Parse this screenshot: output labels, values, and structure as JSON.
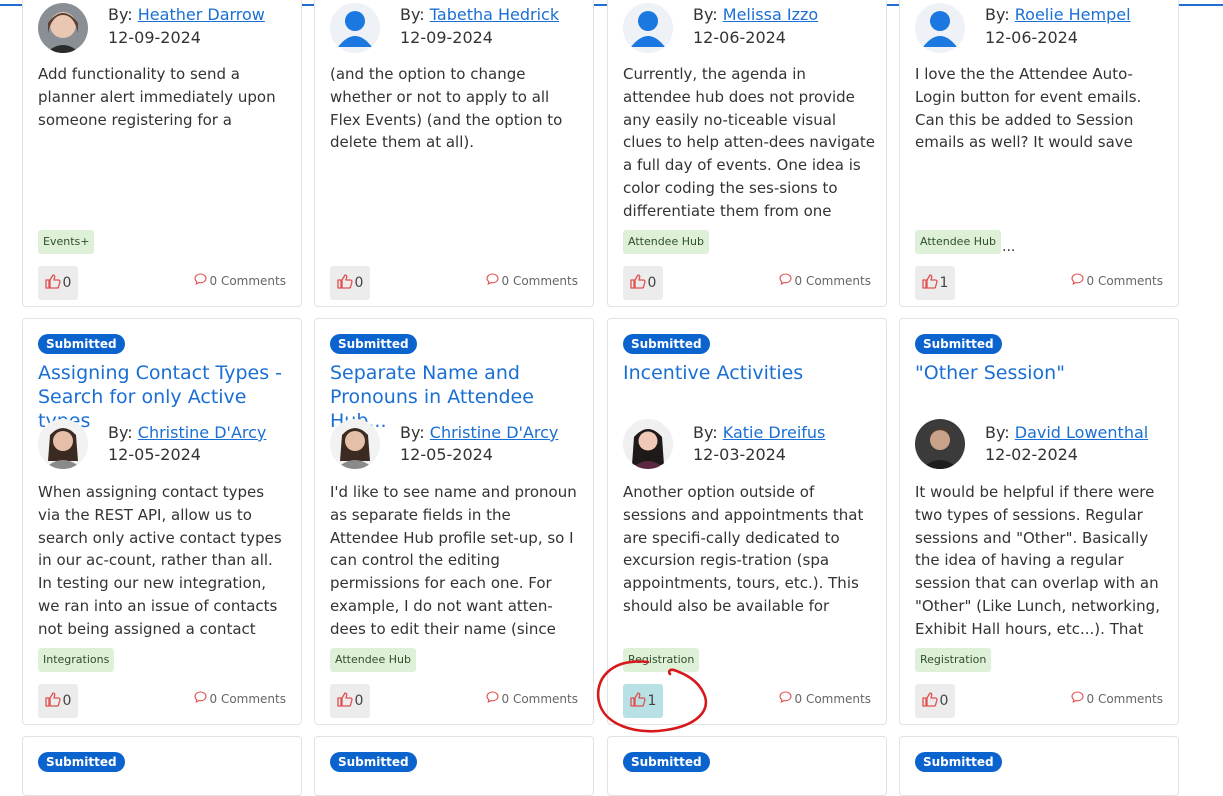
{
  "cards": [
    {
      "author": "Heather Darrow",
      "date": "12-09-2024",
      "description": "Add functionality to send a planner alert immediately upon someone registering for a specific session",
      "tag": "Events+",
      "likes": "0",
      "comments": "0 Comments"
    },
    {
      "author": "Tabetha Hedrick",
      "date": "12-09-2024",
      "description": "(and the option to change whether or not to apply to all Flex Events) (and the option to delete them at all).",
      "likes": "0",
      "comments": "0 Comments"
    },
    {
      "author": "Melissa Izzo",
      "date": "12-06-2024",
      "description": "Currently, the agenda in attendee hub does not provide any easily no-ticeable visual clues to help atten-dees navigate a full day of events. One idea is color coding the ses-sions to differentiate them from one another and make agenda scannin...",
      "tag": "Attendee Hub",
      "likes": "0",
      "comments": "0 Comments"
    },
    {
      "author": "Roelie Hempel",
      "date": "12-06-2024",
      "description": "I love the the Attendee Auto-Login button for event emails. Can this be added to Session emails as well? It would save participants a lot of hassle.",
      "tag": "Attendee Hub",
      "tag_more": "...",
      "likes": "1",
      "comments": "0 Comments"
    },
    {
      "status": "Submitted",
      "title": "Assigning Contact Types - Search for only Active types",
      "author": "Christine D'Arcy",
      "date": "12-05-2024",
      "description": "When assigning contact types via the REST API, allow us to search only active contact types in our ac-count, rather than all. In testing our new integration, we ran into an issue of contacts not being assigned a contact type because our list of...",
      "tag": "Integrations",
      "likes": "0",
      "comments": "0 Comments"
    },
    {
      "status": "Submitted",
      "title": "Separate Name and Pronouns in Attendee Hub...",
      "author": "Christine D'Arcy",
      "date": "12-05-2024",
      "description": "I'd like to see name and pronoun as separate fields in the Attendee Hub profile set-up, so I can control the editing permissions for each one. For example, I do not want atten-dees to edit their name (since invi-tees are added via API) but I would...",
      "tag": "Attendee Hub",
      "likes": "0",
      "comments": "0 Comments"
    },
    {
      "status": "Submitted",
      "title": "Incentive Activities",
      "author": "Katie Dreifus",
      "date": "12-03-2024",
      "description": "Another option outside of sessions and appointments that are specifi-cally dedicated to excursion regis-tration (spa appointments, tours, etc.). This should also be available for guest registration.",
      "tag": "Registration",
      "likes": "1",
      "comments": "0 Comments"
    },
    {
      "status": "Submitted",
      "title": "\"Other Session\"",
      "author": "David Lowenthal",
      "date": "12-02-2024",
      "description": "It would be helpful if there were two types of sessions. Regular sessions and \"Other\". Basically the idea of having a regular session that can overlap with an \"Other\" (Like Lunch, networking, Exhibit Hall hours, etc...). That way the attendee can...",
      "tag": "Registration",
      "likes": "0",
      "comments": "0 Comments"
    },
    {
      "status": "Submitted"
    },
    {
      "status": "Submitted"
    },
    {
      "status": "Submitted"
    },
    {
      "status": "Submitted"
    }
  ],
  "by_label": "By:",
  "accent_color": "#1a6fd4",
  "badge_color": "#0b63ce",
  "annotation_color": "#d8191c"
}
